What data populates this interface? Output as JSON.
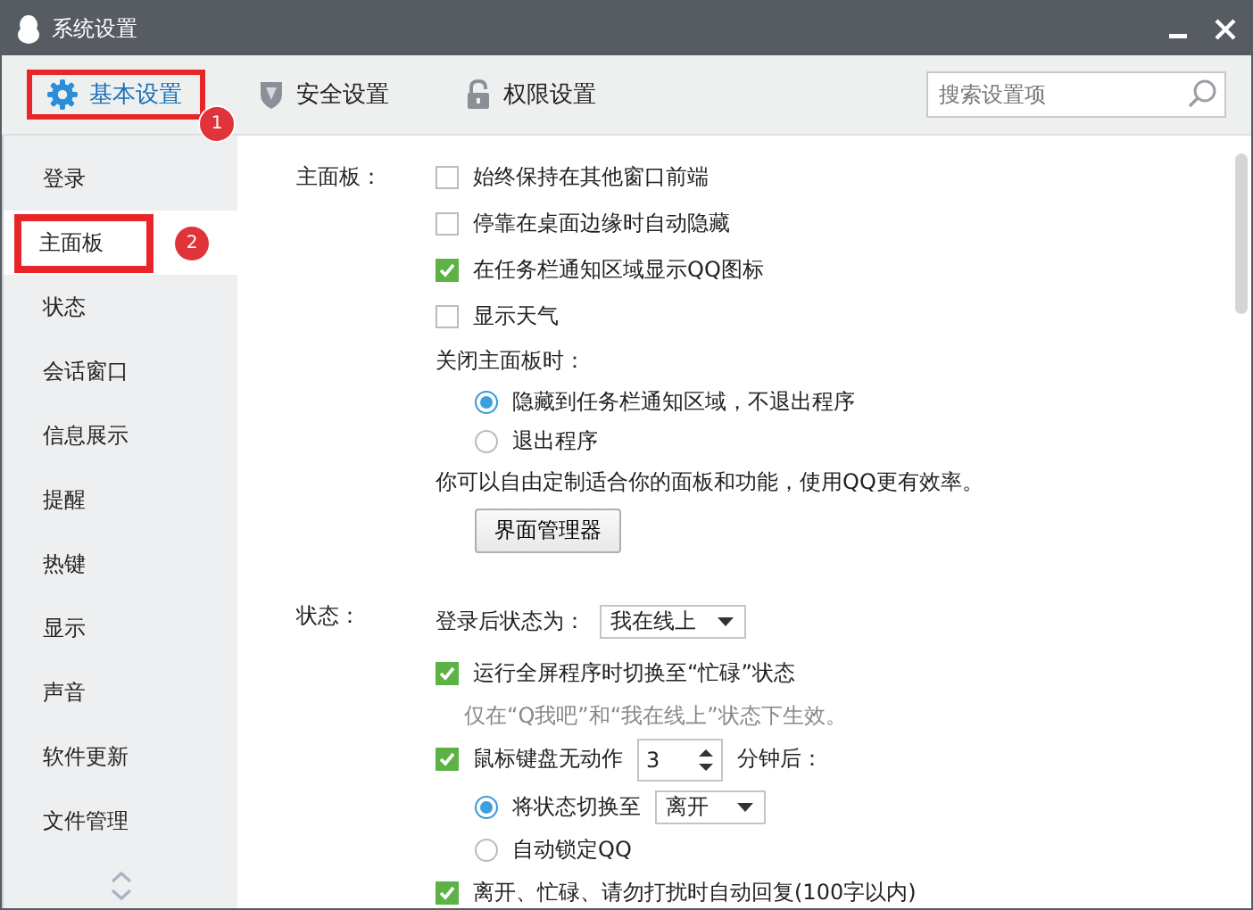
{
  "window": {
    "title": "系统设置"
  },
  "tabs": [
    {
      "label": "基本设置",
      "selected": true,
      "annotation": "1"
    },
    {
      "label": "安全设置",
      "selected": false
    },
    {
      "label": "权限设置",
      "selected": false
    }
  ],
  "search": {
    "placeholder": "搜索设置项"
  },
  "sidebar": {
    "items": [
      {
        "label": "登录",
        "selected": false
      },
      {
        "label": "主面板",
        "selected": true,
        "annotation": "2"
      },
      {
        "label": "状态",
        "selected": false
      },
      {
        "label": "会话窗口",
        "selected": false
      },
      {
        "label": "信息展示",
        "selected": false
      },
      {
        "label": "提醒",
        "selected": false
      },
      {
        "label": "热键",
        "selected": false
      },
      {
        "label": "显示",
        "selected": false
      },
      {
        "label": "声音",
        "selected": false
      },
      {
        "label": "软件更新",
        "selected": false
      },
      {
        "label": "文件管理",
        "selected": false
      }
    ]
  },
  "sections": [
    {
      "title": "主面板：",
      "rows": [
        {
          "kind": "checkbox",
          "label": "始终保持在其他窗口前端",
          "checked": false
        },
        {
          "kind": "checkbox",
          "label": "停靠在桌面边缘时自动隐藏",
          "checked": false
        },
        {
          "kind": "checkbox",
          "label": "在任务栏通知区域显示QQ图标",
          "checked": true
        },
        {
          "kind": "checkbox",
          "label": "显示天气",
          "checked": false
        },
        {
          "kind": "text",
          "label": "关闭主面板时："
        },
        {
          "kind": "radio",
          "label": "隐藏到任务栏通知区域，不退出程序",
          "selected": true
        },
        {
          "kind": "radio",
          "label": "退出程序",
          "selected": false
        },
        {
          "kind": "text",
          "label": "你可以自由定制适合你的面板和功能，使用QQ更有效率。"
        },
        {
          "kind": "button",
          "label": "界面管理器"
        }
      ]
    },
    {
      "title": "状态：",
      "rows": [
        {
          "kind": "select",
          "label": "登录后状态为：",
          "value": "我在线上"
        },
        {
          "kind": "checkbox",
          "label": "运行全屏程序时切换至“忙碌”状态",
          "checked": true
        },
        {
          "kind": "hint",
          "label": "仅在“Q我吧”和“我在线上”状态下生效。"
        },
        {
          "kind": "spin",
          "label": "鼠标键盘无动作",
          "checked": true,
          "value": "3",
          "suffix": "分钟后："
        },
        {
          "kind": "radio-select",
          "label": "将状态切换至",
          "selected": true,
          "value": "离开"
        },
        {
          "kind": "radio",
          "label": "自动锁定QQ",
          "selected": false
        },
        {
          "kind": "checkbox",
          "label": "离开、忙碌、请勿打扰时自动回复(100字以内)",
          "checked": true
        }
      ]
    }
  ]
}
